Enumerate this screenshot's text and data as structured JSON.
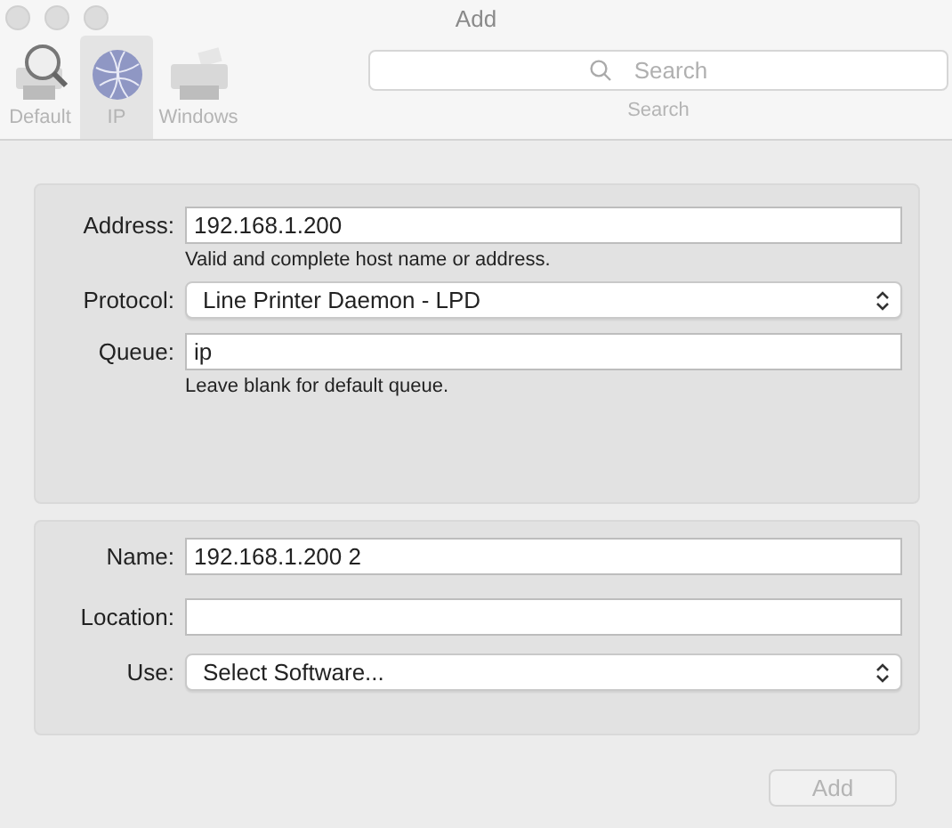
{
  "window": {
    "title": "Add"
  },
  "toolbar": {
    "items": [
      {
        "label": "Default",
        "kind": "printer-search",
        "selected": false
      },
      {
        "label": "IP",
        "kind": "globe",
        "selected": true
      },
      {
        "label": "Windows",
        "kind": "printer",
        "selected": false
      }
    ],
    "search": {
      "placeholder": "Search",
      "label": "Search"
    }
  },
  "connection_panel": {
    "rows": [
      {
        "label": "Address:",
        "kind": "text",
        "value": "192.168.1.200",
        "hint": "Valid and complete host name or address."
      },
      {
        "label": "Protocol:",
        "kind": "select",
        "value": "Line Printer Daemon - LPD"
      },
      {
        "label": "Queue:",
        "kind": "text",
        "value": "ip",
        "hint": "Leave blank for default queue."
      }
    ]
  },
  "printer_panel": {
    "rows": [
      {
        "label": "Name:",
        "kind": "text",
        "value": "192.168.1.200 2"
      },
      {
        "label": "Location:",
        "kind": "text",
        "value": ""
      },
      {
        "label": "Use:",
        "kind": "select",
        "value": "Select Software..."
      }
    ]
  },
  "add_button": {
    "label": "Add",
    "disabled": true
  }
}
